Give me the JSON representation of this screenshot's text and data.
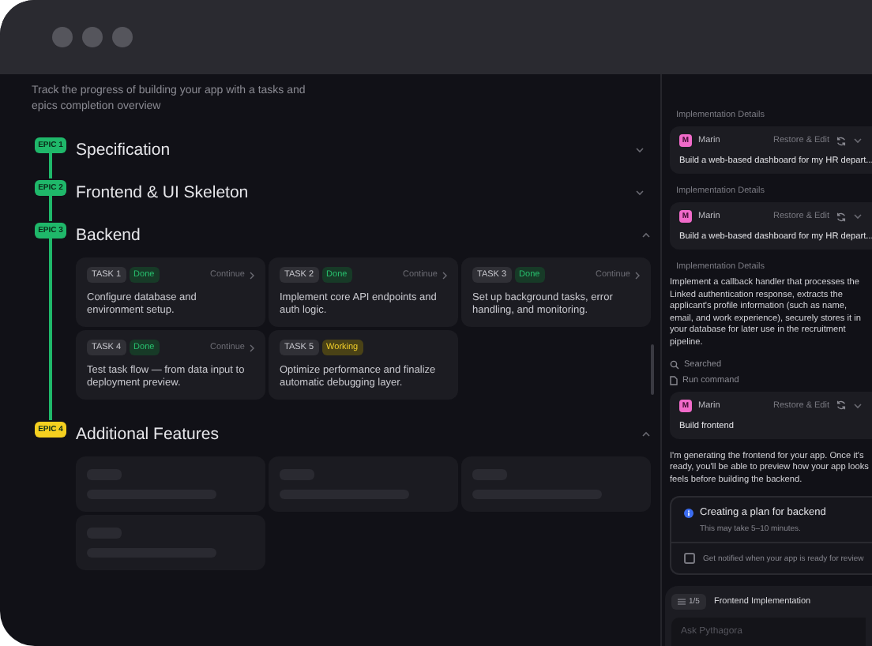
{
  "subtitle": "Track the progress of building your app with a tasks and epics completion overview",
  "epics": [
    {
      "badge": "EPIC 1",
      "title": "Specification",
      "color": "#1fb86a",
      "expanded": false
    },
    {
      "badge": "EPIC 2",
      "title": "Frontend & UI Skeleton",
      "color": "#1fb86a",
      "expanded": false
    },
    {
      "badge": "EPIC 3",
      "title": "Backend",
      "color": "#1fb86a",
      "expanded": true,
      "loading": false,
      "tasks": [
        {
          "tag": "TASK 1",
          "status": "Done",
          "kind": "done",
          "action": "Continue",
          "description": "Configure database and environment setup."
        },
        {
          "tag": "TASK 2",
          "status": "Done",
          "kind": "done",
          "action": "Continue",
          "description": "Implement core API endpoints and auth logic."
        },
        {
          "tag": "TASK 3",
          "status": "Done",
          "kind": "done",
          "action": "Continue",
          "description": "Set up background tasks, error handling, and monitoring."
        },
        {
          "tag": "TASK 4",
          "status": "Done",
          "kind": "done",
          "action": "Continue",
          "description": "Test task flow — from data input to deployment preview."
        },
        {
          "tag": "TASK 5",
          "status": "Working",
          "kind": "working",
          "description": "Optimize performance and finalize automatic debugging layer."
        }
      ]
    },
    {
      "badge": "EPIC 4",
      "title": "Additional Features",
      "color": "#f5d020",
      "expanded": true,
      "loading": true
    }
  ],
  "chat": [
    {
      "kind": "section",
      "text": "Implementation Details"
    },
    {
      "kind": "user",
      "avatar": "M",
      "name": "Marin",
      "action": "Restore & Edit",
      "text": "Build a web-based dashboard for my HR depart..."
    },
    {
      "kind": "section",
      "text": "Implementation Details"
    },
    {
      "kind": "user",
      "avatar": "M",
      "name": "Marin",
      "action": "Restore & Edit",
      "text": "Build a web-based dashboard for my HR depart..."
    },
    {
      "kind": "section",
      "text": "Implementation Details"
    },
    {
      "kind": "paragraph",
      "text": "Implement a callback handler that processes the Linked authentication response, extracts the applicant's profile information (such as name, email, and work experience), securely stores it in your database for later use in the recruitment pipeline."
    },
    {
      "kind": "search_step",
      "text": "Searched"
    },
    {
      "kind": "command_step",
      "text": "Run command"
    },
    {
      "kind": "user",
      "avatar": "M",
      "name": "Marin",
      "action": "Restore & Edit",
      "text": "Build frontend"
    },
    {
      "kind": "paragraph",
      "text": "I'm generating the frontend for your app. Once it's ready, you'll be able to preview how your app looks feels before building the backend."
    },
    {
      "kind": "plan",
      "title": "Creating a plan for backend",
      "note": "This may take 5–10 minutes.",
      "checkbox": {
        "label": "Get notified when your app is ready for review",
        "checked": false
      }
    }
  ],
  "composer": {
    "counter": "1/5",
    "task": "Frontend Implementation",
    "placeholder": "Ask Pythagora"
  }
}
